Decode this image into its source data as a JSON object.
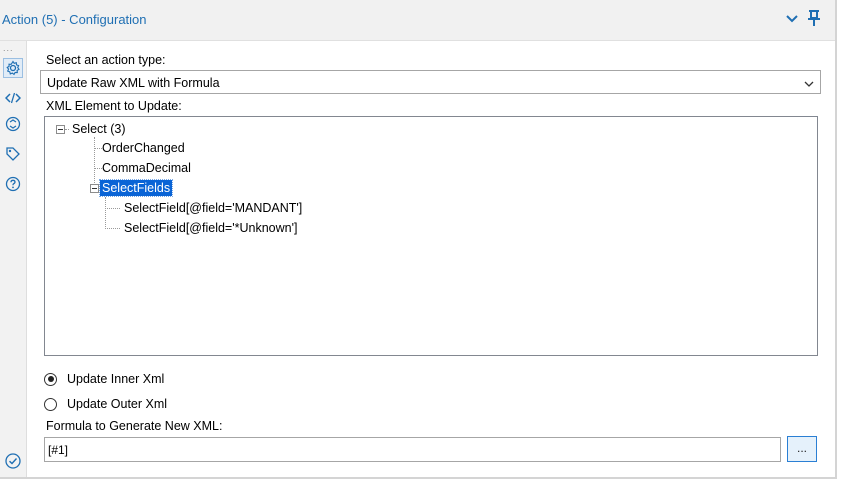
{
  "window": {
    "title": "Action (5) - Configuration"
  },
  "rail": {
    "dots": "...",
    "icons": [
      "gear-icon",
      "code-icon",
      "tool-icon",
      "tag-icon",
      "help-icon"
    ],
    "bottom_icon": "check-circle-icon"
  },
  "action_type": {
    "label": "Select an action type:",
    "value": "Update Raw XML with Formula"
  },
  "xml_element": {
    "label": "XML Element to Update:",
    "tree": {
      "root": "Select (3)",
      "children": [
        "OrderChanged",
        "CommaDecimal",
        "SelectFields"
      ],
      "grandchildren": [
        "SelectField[@field='MANDANT']",
        "SelectField[@field='*Unknown']"
      ],
      "selected": "SelectFields"
    }
  },
  "update_mode": {
    "inner_label": "Update Inner Xml",
    "outer_label": "Update Outer Xml",
    "selected": "inner"
  },
  "formula": {
    "label": "Formula to Generate New XML:",
    "value": "[#1]",
    "button_label": "..."
  },
  "colors": {
    "title": "#1f6fb3",
    "selection": "#0a64d6",
    "accent_button_border": "#2a7fd4"
  }
}
